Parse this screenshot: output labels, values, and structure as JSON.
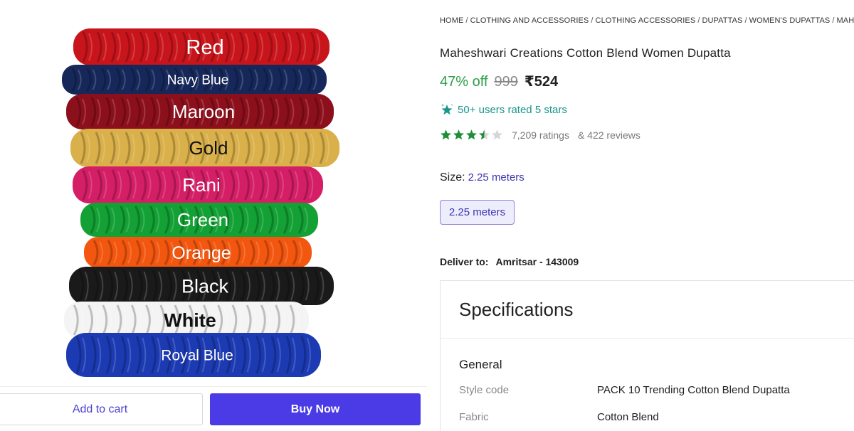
{
  "image": {
    "colors": [
      {
        "label": "Red",
        "fill": "#c8151c"
      },
      {
        "label": "Navy Blue",
        "fill": "#16275a"
      },
      {
        "label": "Maroon",
        "fill": "#8c0f1c"
      },
      {
        "label": "Gold",
        "fill": "#d9b04a"
      },
      {
        "label": "Rani",
        "fill": "#d41e66"
      },
      {
        "label": "Green",
        "fill": "#13a034"
      },
      {
        "label": "Orange",
        "fill": "#f2560f"
      },
      {
        "label": "Black",
        "fill": "#1a1a1a"
      },
      {
        "label": "White",
        "fill": "#f4f4f4"
      },
      {
        "label": "Royal Blue",
        "fill": "#1c3ab2"
      }
    ]
  },
  "actions": {
    "add_to_cart": "Add to cart",
    "buy_now": "Buy Now"
  },
  "breadcrumb": [
    "HOME",
    "CLOTHING AND ACCESSORIES",
    "CLOTHING ACCESSORIES",
    "DUPATTAS",
    "WOMEN'S DUPATTAS",
    "MAHES"
  ],
  "product": {
    "title": "Maheshwari Creations Cotton Blend Women Dupatta",
    "discount": "47% off",
    "mrp": "999",
    "price": "₹524",
    "rated_text": "50+ users rated 5 stars",
    "rating_value": 3.5,
    "ratings": "7,209 ratings",
    "reviews": "& 422 reviews",
    "size_label": "Size:",
    "size_value": "2.25 meters",
    "size_options": [
      "2.25 meters"
    ],
    "deliver_label": "Deliver to:",
    "deliver_value": "Amritsar - 143009"
  },
  "specifications": {
    "title": "Specifications",
    "group": "General",
    "rows": [
      {
        "key": "Style code",
        "value": "PACK 10 Trending Cotton Blend Dupatta"
      },
      {
        "key": "Fabric",
        "value": "Cotton Blend"
      }
    ]
  },
  "theme": {
    "accent": "#4b3be6",
    "discount_green": "#2e9e46",
    "star_green": "#1f8e3a",
    "teal": "#19968a"
  }
}
